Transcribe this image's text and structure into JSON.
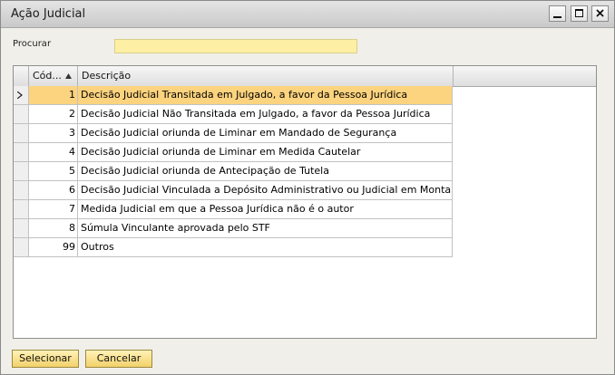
{
  "window": {
    "title": "Ação Judicial"
  },
  "search": {
    "label": "Procurar",
    "value": ""
  },
  "table": {
    "headers": {
      "code": "Cód...",
      "description": "Descrição"
    },
    "rows": [
      {
        "code": "1",
        "description": "Decisão Judicial Transitada em Julgado, a favor da Pessoa Jurídica"
      },
      {
        "code": "2",
        "description": "Decisão Judicial Não Transitada em Julgado, a favor da Pessoa Jurídica"
      },
      {
        "code": "3",
        "description": "Decisão Judicial oriunda de Liminar em Mandado de Segurança"
      },
      {
        "code": "4",
        "description": "Decisão Judicial oriunda de Liminar em Medida Cautelar"
      },
      {
        "code": "5",
        "description": "Decisão Judicial oriunda de Antecipação de Tutela"
      },
      {
        "code": "6",
        "description": "Decisão Judicial Vinculada a Depósito Administrativo ou Judicial em Montante Integral"
      },
      {
        "code": "7",
        "description": "Medida Judicial em que a Pessoa Jurídica não é o autor"
      },
      {
        "code": "8",
        "description": "Súmula Vinculante aprovada pelo STF"
      },
      {
        "code": "99",
        "description": "Outros"
      }
    ]
  },
  "buttons": {
    "select": "Selecionar",
    "cancel": "Cancelar"
  },
  "colors": {
    "selected_row": "#fcd37e",
    "search_field": "#fdf0a4",
    "button": "#f2d16a"
  }
}
